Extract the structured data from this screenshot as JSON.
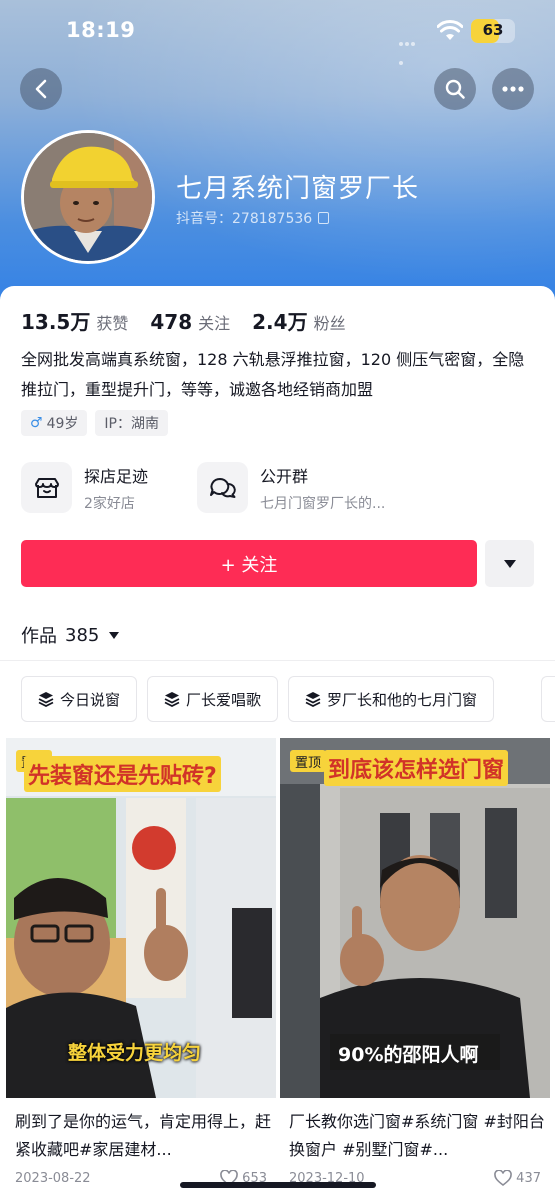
{
  "status_bar": {
    "time": "18:19",
    "battery": "63",
    "battery_level": 0.63
  },
  "profile": {
    "nickname": "七月系统门窗罗厂长",
    "douyin_id": "抖音号：278187536"
  },
  "stats": [
    {
      "value": "13.5万",
      "label": "获赞"
    },
    {
      "value": "478",
      "label": "关注"
    },
    {
      "value": "2.4万",
      "label": "粉丝"
    }
  ],
  "bio": "全网批发高端真系统窗，128 六轨悬浮推拉窗，120 侧压气密窗，全隐推拉门，重型提升门，等等，诚邀各地经销商加盟",
  "tags": {
    "gender_symbol": "♂",
    "age": "49岁",
    "ip": "IP：湖南"
  },
  "features": {
    "shop": {
      "title": "探店足迹",
      "subtitle": "2家好店"
    },
    "group": {
      "title": "公开群",
      "subtitle": "七月门窗罗厂长的..."
    }
  },
  "follow_button": {
    "label": "+ 关注"
  },
  "works": {
    "label": "作品",
    "count": "385"
  },
  "collections": [
    "今日说窗",
    "厂长爱唱歌",
    "罗厂长和他的七月门窗"
  ],
  "videos": [
    {
      "pin": "置顶",
      "caption_top": "先装窗还是先贴砖?",
      "caption_bottom": "整体受力更均匀",
      "title": "刷到了是你的运气，肯定用得上，赶紧收藏吧#家居建材...",
      "date": "2023-08-22",
      "likes": "653"
    },
    {
      "pin": "置顶",
      "caption_top": "到底该怎样选门窗",
      "caption_bottom": "90%的邵阳人啊",
      "title": "厂长教你选门窗#系统门窗 #封阳台换窗户 #别墅门窗#...",
      "date": "2023-12-10",
      "likes": "437"
    }
  ],
  "colors": {
    "accent": "#fe2c55",
    "pin": "#f7d33b",
    "header": "#4b8ee0"
  },
  "icons": [
    "back-icon",
    "search-icon",
    "more-icon",
    "copy-icon",
    "shop-icon",
    "group-chat-icon",
    "chevron-down-icon",
    "collection-icon",
    "heart-icon"
  ]
}
